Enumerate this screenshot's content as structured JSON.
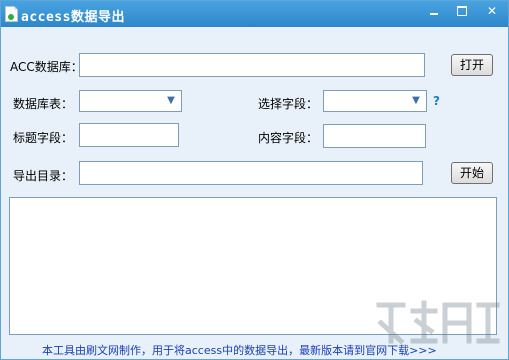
{
  "window": {
    "title": "access数据导出",
    "minimize_glyph": "",
    "close_glyph": "✕"
  },
  "form": {
    "acc_label": "ACC数据库：",
    "acc_value": "",
    "open_button": "打开",
    "table_label": "数据库表：",
    "table_value": "",
    "field_label": "选择字段：",
    "field_value": "",
    "help_glyph": "?",
    "title_field_label": "标题字段：",
    "title_field_value": "",
    "content_field_label": "内容字段：",
    "content_field_value": "",
    "export_dir_label": "导出目录：",
    "export_dir_value": "",
    "start_button": "开始"
  },
  "log": {
    "text": ""
  },
  "footer": {
    "text": "本工具由刷文网制作，用于将access中的数据导出，最新版本请到官网下载>>>"
  },
  "colors": {
    "titlebar": "#2d86c9",
    "window_bg": "#e8f1f9",
    "footer_link": "#1a3fb5",
    "help": "#1b7fd4"
  },
  "icons": {
    "app": "document-icon",
    "minimize": "minimize-icon",
    "maximize": "maximize-icon",
    "close": "close-icon",
    "dropdown": "chevron-down-icon"
  }
}
